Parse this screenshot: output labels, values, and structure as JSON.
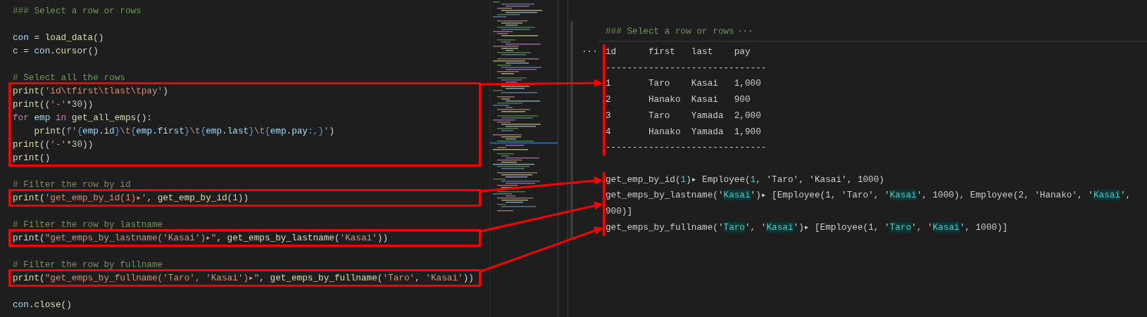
{
  "editor": {
    "blocks": [
      {
        "boxed": false,
        "lines": [
          {
            "kind": "code",
            "tokens": [
              {
                "text": "### Select a row or rows",
                "kind": "comment"
              }
            ]
          },
          {
            "kind": "blank"
          },
          {
            "kind": "code",
            "tokens": [
              {
                "text": "con",
                "kind": "var"
              },
              {
                "text": " = ",
                "kind": "punct"
              },
              {
                "text": "load_data",
                "kind": "func"
              },
              {
                "text": "()",
                "kind": "punct"
              }
            ]
          },
          {
            "kind": "code",
            "tokens": [
              {
                "text": "c",
                "kind": "var"
              },
              {
                "text": " = ",
                "kind": "punct"
              },
              {
                "text": "con",
                "kind": "var"
              },
              {
                "text": ".",
                "kind": "punct"
              },
              {
                "text": "cursor",
                "kind": "func"
              },
              {
                "text": "()",
                "kind": "punct"
              }
            ]
          },
          {
            "kind": "blank"
          },
          {
            "kind": "code",
            "tokens": [
              {
                "text": "# Select all the rows",
                "kind": "comment"
              }
            ]
          }
        ]
      },
      {
        "boxed": true,
        "lines": [
          {
            "kind": "code",
            "tokens": [
              {
                "text": "print",
                "kind": "func"
              },
              {
                "text": "(",
                "kind": "punct"
              },
              {
                "text": "'id\\tfirst\\tlast\\tpay'",
                "kind": "string"
              },
              {
                "text": ")",
                "kind": "punct"
              }
            ]
          },
          {
            "kind": "code",
            "tokens": [
              {
                "text": "print",
                "kind": "func"
              },
              {
                "text": "((",
                "kind": "punct"
              },
              {
                "text": "'-'",
                "kind": "string"
              },
              {
                "text": "*",
                "kind": "punct"
              },
              {
                "text": "30",
                "kind": "number"
              },
              {
                "text": "))",
                "kind": "punct"
              }
            ]
          },
          {
            "kind": "code",
            "tokens": [
              {
                "text": "for",
                "kind": "keyword"
              },
              {
                "text": " emp ",
                "kind": "var"
              },
              {
                "text": "in",
                "kind": "keyword"
              },
              {
                "text": " get_all_emps",
                "kind": "func"
              },
              {
                "text": "():",
                "kind": "punct"
              }
            ]
          },
          {
            "kind": "code",
            "tokens": [
              {
                "text": "    print",
                "kind": "func"
              },
              {
                "text": "(",
                "kind": "punct"
              },
              {
                "text": "f",
                "kind": "storage"
              },
              {
                "text": "'",
                "kind": "string"
              },
              {
                "text": "{",
                "kind": "storage"
              },
              {
                "text": "emp",
                "kind": "var"
              },
              {
                "text": ".",
                "kind": "punct"
              },
              {
                "text": "id",
                "kind": "var"
              },
              {
                "text": "}",
                "kind": "storage"
              },
              {
                "text": "\\t",
                "kind": "string"
              },
              {
                "text": "{",
                "kind": "storage"
              },
              {
                "text": "emp",
                "kind": "var"
              },
              {
                "text": ".",
                "kind": "punct"
              },
              {
                "text": "first",
                "kind": "var"
              },
              {
                "text": "}",
                "kind": "storage"
              },
              {
                "text": "\\t",
                "kind": "string"
              },
              {
                "text": "{",
                "kind": "storage"
              },
              {
                "text": "emp",
                "kind": "var"
              },
              {
                "text": ".",
                "kind": "punct"
              },
              {
                "text": "last",
                "kind": "var"
              },
              {
                "text": "}",
                "kind": "storage"
              },
              {
                "text": "\\t",
                "kind": "string"
              },
              {
                "text": "{",
                "kind": "storage"
              },
              {
                "text": "emp",
                "kind": "var"
              },
              {
                "text": ".",
                "kind": "punct"
              },
              {
                "text": "pay",
                "kind": "var"
              },
              {
                "text": ":,",
                "kind": "storage"
              },
              {
                "text": "}",
                "kind": "storage"
              },
              {
                "text": "'",
                "kind": "string"
              },
              {
                "text": ")",
                "kind": "punct"
              }
            ]
          },
          {
            "kind": "code",
            "tokens": [
              {
                "text": "print",
                "kind": "func"
              },
              {
                "text": "((",
                "kind": "punct"
              },
              {
                "text": "'-'",
                "kind": "string"
              },
              {
                "text": "*",
                "kind": "punct"
              },
              {
                "text": "30",
                "kind": "number"
              },
              {
                "text": "))",
                "kind": "punct"
              }
            ]
          },
          {
            "kind": "code",
            "tokens": [
              {
                "text": "print",
                "kind": "func"
              },
              {
                "text": "()",
                "kind": "punct"
              }
            ]
          }
        ]
      },
      {
        "boxed": false,
        "lines": [
          {
            "kind": "blank"
          },
          {
            "kind": "code",
            "tokens": [
              {
                "text": "# Filter the row by id",
                "kind": "comment"
              }
            ]
          }
        ]
      },
      {
        "boxed": true,
        "lines": [
          {
            "kind": "code",
            "tokens": [
              {
                "text": "print",
                "kind": "func"
              },
              {
                "text": "(",
                "kind": "punct"
              },
              {
                "text": "'get_emp_by_id(1)▸'",
                "kind": "string"
              },
              {
                "text": ", ",
                "kind": "punct"
              },
              {
                "text": "get_emp_by_id",
                "kind": "func"
              },
              {
                "text": "(",
                "kind": "punct"
              },
              {
                "text": "1",
                "kind": "number"
              },
              {
                "text": "))",
                "kind": "punct"
              }
            ]
          }
        ]
      },
      {
        "boxed": false,
        "lines": [
          {
            "kind": "blank"
          },
          {
            "kind": "code",
            "tokens": [
              {
                "text": "# Filter the row by lastname",
                "kind": "comment"
              }
            ]
          }
        ]
      },
      {
        "boxed": true,
        "lines": [
          {
            "kind": "code",
            "tokens": [
              {
                "text": "print",
                "kind": "func"
              },
              {
                "text": "(",
                "kind": "punct"
              },
              {
                "text": "\"get_emps_by_lastname('Kasai')▸\"",
                "kind": "string"
              },
              {
                "text": ", ",
                "kind": "punct"
              },
              {
                "text": "get_emps_by_lastname",
                "kind": "func"
              },
              {
                "text": "(",
                "kind": "punct"
              },
              {
                "text": "'Kasai'",
                "kind": "string"
              },
              {
                "text": "))",
                "kind": "punct"
              }
            ]
          }
        ]
      },
      {
        "boxed": false,
        "lines": [
          {
            "kind": "blank"
          },
          {
            "kind": "code",
            "tokens": [
              {
                "text": "# Filter the row by fullname",
                "kind": "comment"
              }
            ]
          }
        ]
      },
      {
        "boxed": true,
        "lines": [
          {
            "kind": "code",
            "tokens": [
              {
                "text": "print",
                "kind": "func"
              },
              {
                "text": "(",
                "kind": "punct"
              },
              {
                "text": "\"get_emps_by_fullname('Taro', 'Kasai')▸\"",
                "kind": "string"
              },
              {
                "text": ", ",
                "kind": "punct"
              },
              {
                "text": "get_emps_by_fullname",
                "kind": "func"
              },
              {
                "text": "(",
                "kind": "punct"
              },
              {
                "text": "'Taro'",
                "kind": "string"
              },
              {
                "text": ", ",
                "kind": "punct"
              },
              {
                "text": "'Kasai'",
                "kind": "string"
              },
              {
                "text": "))",
                "kind": "punct"
              }
            ]
          }
        ]
      },
      {
        "boxed": false,
        "lines": [
          {
            "kind": "blank"
          },
          {
            "kind": "code",
            "tokens": [
              {
                "text": "con",
                "kind": "var"
              },
              {
                "text": ".",
                "kind": "punct"
              },
              {
                "text": "close",
                "kind": "func"
              },
              {
                "text": "()",
                "kind": "punct"
              }
            ]
          }
        ]
      }
    ]
  },
  "output": {
    "heading": {
      "text": "### Select a row or rows",
      "ellipsis": "···"
    },
    "cell_menu": "···",
    "blocks": [
      {
        "marked": true,
        "lines": [
          {
            "kind": "text",
            "segments": [
              {
                "text": "id      first   last    pay",
                "kind": "plain"
              }
            ]
          },
          {
            "kind": "text",
            "segments": [
              {
                "text": "------------------------------",
                "kind": "plain"
              }
            ]
          },
          {
            "kind": "text",
            "segments": [
              {
                "text": "1       Taro    Kasai   1,000",
                "kind": "plain"
              }
            ]
          },
          {
            "kind": "text",
            "segments": [
              {
                "text": "2       Hanako  Kasai   900",
                "kind": "plain"
              }
            ]
          },
          {
            "kind": "text",
            "segments": [
              {
                "text": "3       Taro    Yamada  2,000",
                "kind": "plain"
              }
            ]
          },
          {
            "kind": "text",
            "segments": [
              {
                "text": "4       Hanako  Yamada  1,900",
                "kind": "plain"
              }
            ]
          },
          {
            "kind": "text",
            "segments": [
              {
                "text": "------------------------------",
                "kind": "plain"
              }
            ]
          }
        ]
      },
      {
        "marked": false,
        "lines": [
          {
            "kind": "blank"
          }
        ]
      },
      {
        "marked": true,
        "lines": [
          {
            "kind": "text",
            "segments": [
              {
                "text": "get_emp_by_id(",
                "kind": "plain"
              },
              {
                "text": "1",
                "kind": "number"
              },
              {
                "text": ")▸ Employee(",
                "kind": "plain"
              },
              {
                "text": "1",
                "kind": "number"
              },
              {
                "text": ", 'Taro', 'Kasai', 1000)",
                "kind": "plain"
              }
            ]
          }
        ]
      },
      {
        "marked": true,
        "lines": [
          {
            "kind": "text",
            "segments": [
              {
                "text": "get_emps_by_lastname('",
                "kind": "plain"
              },
              {
                "text": "Kasai",
                "kind": "match"
              },
              {
                "text": "')▸ [Employee(1, 'Taro', '",
                "kind": "plain"
              },
              {
                "text": "Kasai",
                "kind": "match"
              },
              {
                "text": "', 1000), Employee(2, 'Hanako', '",
                "kind": "plain"
              },
              {
                "text": "Kasai",
                "kind": "match"
              },
              {
                "text": "', 900)]",
                "kind": "plain"
              }
            ]
          }
        ]
      },
      {
        "marked": true,
        "lines": [
          {
            "kind": "text",
            "segments": [
              {
                "text": "get_emps_by_fullname('",
                "kind": "plain"
              },
              {
                "text": "Taro",
                "kind": "match"
              },
              {
                "text": "', '",
                "kind": "plain"
              },
              {
                "text": "Kasai",
                "kind": "match"
              },
              {
                "text": "')▸ [Employee(1, '",
                "kind": "plain"
              },
              {
                "text": "Taro",
                "kind": "match"
              },
              {
                "text": "', '",
                "kind": "plain"
              },
              {
                "text": "Kasai",
                "kind": "match"
              },
              {
                "text": "', 1000)]",
                "kind": "plain"
              }
            ]
          }
        ]
      }
    ]
  }
}
